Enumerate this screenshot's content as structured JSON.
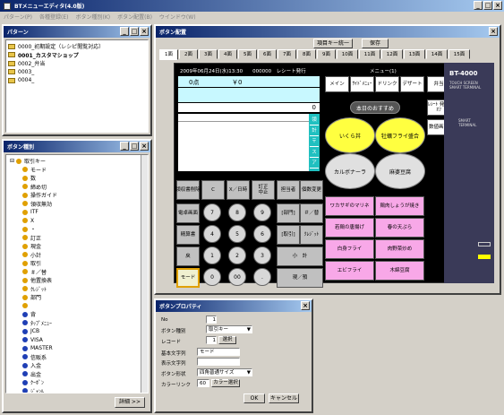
{
  "app": {
    "title": "BTメニューエディタ(4.0版)"
  },
  "menubar": [
    "パターン(P)",
    "各種登録(E)",
    "ボタン種別(K)",
    "ボタン配置(B)",
    "ウインドウ(W)"
  ],
  "pattern_panel": {
    "title": "パターン",
    "items": [
      "0000_初期設定（レシピ閲覧対応）",
      "0001_カスタマショップ",
      "0002_弁当",
      "0003_",
      "0004_"
    ]
  },
  "button_type_panel": {
    "title": "ボタン種別",
    "root": "取引キー",
    "items": [
      "モード",
      "数",
      "締め切",
      "操作ガイド",
      "領収無効",
      "ITF",
      "X",
      "・",
      "訂正",
      "現金",
      "小計",
      "取引",
      "＃／替",
      "他置換表",
      "ｸﾚｼﾞｯﾄ",
      "部門",
      "",
      "背",
      "ﾀｯﾌﾟﾒﾆｭｰ",
      "JCB",
      "VISA",
      "MASTER",
      "信販系",
      "入金",
      "出金",
      "ｸｰﾎﾟﾝ",
      "ｼﾞｬﾝﾙ",
      "ドリンク",
      "デザート",
      "-",
      "ｻﾗｰ"
    ],
    "detail_button": "詳細 >>"
  },
  "layout_panel": {
    "title": "ボタン配置",
    "top_buttons": [
      "項目キー統一",
      "保存"
    ],
    "tabs": [
      "1面",
      "2面",
      "3面",
      "4面",
      "5面",
      "6面",
      "7面",
      "8面",
      "9面",
      "10面",
      "11面",
      "12面",
      "13面",
      "14面",
      "15面"
    ],
    "receipt_header": "2009年06月24日(水)13:30　　000000　レシート発行",
    "amount_points": "0点",
    "amount_yen": "￥0",
    "total": "0",
    "menu_title": "メニュー(1)",
    "device_model": "BT-4000",
    "device_sub": "TOUCH SCREEN SMART TERMINAL",
    "device_sub2": "SMART TERMINAL",
    "side_keys": [
      "領",
      "計",
      "〒",
      "ス",
      "ア"
    ],
    "category_buttons": [
      "メイン",
      "ｻｲﾄﾞﾒﾆｭｰ",
      "ドリンク",
      "デザート",
      "弁当"
    ],
    "daily_special": "本日のおすすめ",
    "yellow_circles": [
      "いくら丼",
      "牡蠣フライ盛合"
    ],
    "white_circles": [
      "カルボナーラ",
      "麻婆豆腐"
    ],
    "right_buttons": [
      "ﾚｼｰﾄ 発行 ｵﾌ",
      "数値画面"
    ],
    "ops_row": [
      "領収書削除",
      "C",
      "X／日時",
      "訂正\n中止",
      "担当者",
      "個数変更"
    ],
    "left_keys": [
      "電卓画面",
      "精算書",
      "戻",
      "モード"
    ],
    "numpad": [
      "7",
      "8",
      "9",
      "4",
      "5",
      "6",
      "1",
      "2",
      "3",
      "0",
      "00",
      "."
    ],
    "mid_keys": [
      "[部門]",
      "＃／替",
      "[取引]",
      "ｸﾚｼﾞｯﾄ",
      "小　計",
      "現／預"
    ],
    "pink_keys": [
      "ワカサギのマリネ",
      "鶏肉しょうが焼き",
      "若鶏の唐揚げ",
      "春の天ぷら",
      "白身フライ",
      "肉野菜炒め",
      "エビフライ",
      "木綿豆腐"
    ]
  },
  "props_panel": {
    "title": "ボタンプロパティ",
    "no_label": "No",
    "no_value": "1",
    "type_label": "ボタン種別",
    "type_value": "取引キー",
    "code_label": "レコード",
    "code_value": "1",
    "select_button": "選択",
    "basic_label": "基本文字列",
    "basic_value": "モード",
    "display_label": "表示文字列",
    "display_value": "",
    "shape_label": "ボタン形状",
    "shape_value": "四角普通サイズ",
    "color_label": "カラーリンク",
    "color_value": "60",
    "color_button": "カラー選択",
    "ok": "OK",
    "cancel": "キャンセル"
  }
}
